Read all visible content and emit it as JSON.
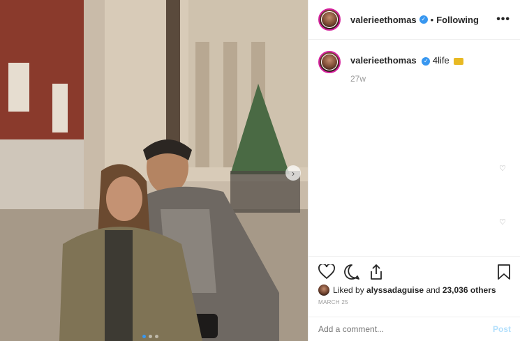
{
  "post": {
    "username": "valerieethomas",
    "separator": "•",
    "follow_status": "Following",
    "more_label": "•••",
    "caption_username": "valerieethomas",
    "caption_text": "4life",
    "time_ago": "27w",
    "liked_prefix": "Liked by",
    "liked_user": "alyssadaguise",
    "liked_middle": "and",
    "liked_count": "23,036 others",
    "date": "MARCH 25",
    "comment_placeholder": "Add a comment...",
    "post_label": "Post"
  },
  "icons": {
    "more": "more-options-icon",
    "verified": "verified-badge-icon",
    "crown": "crown-emoji-icon",
    "like": "heart-icon",
    "comment": "comment-icon",
    "share": "share-icon",
    "save": "bookmark-icon",
    "next": "chevron-right-icon"
  },
  "colors": {
    "accent": "#3897f0",
    "post_disabled": "#b2dffc",
    "muted": "#999999"
  },
  "carousel": {
    "total": 3,
    "active_index": 0
  }
}
